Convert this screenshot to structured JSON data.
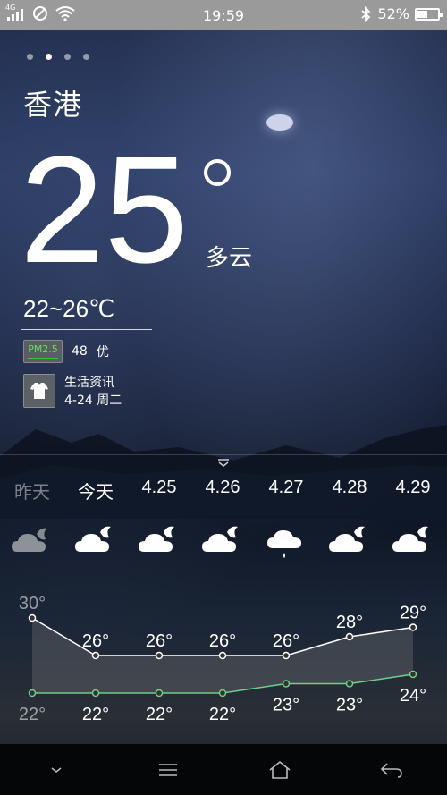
{
  "status_bar": {
    "network": "4G",
    "time": "19:59",
    "battery_percent": "52%",
    "battery_level": 0.52,
    "icons": [
      "signal-icon",
      "do-not-disturb-icon",
      "wifi-icon",
      "bluetooth-icon",
      "battery-icon"
    ]
  },
  "pager": {
    "count": 4,
    "active_index": 1
  },
  "current": {
    "city": "香港",
    "temperature": "25",
    "condition": "多云",
    "range": "22~26℃",
    "pm_label": "PM2.5",
    "pm_value": "48",
    "pm_quality": "优",
    "life_title": "生活资讯",
    "life_date": "4-24 周二"
  },
  "forecast": {
    "days": [
      {
        "label": "昨天",
        "icon": "cloudy-night-icon",
        "past": true
      },
      {
        "label": "今天",
        "icon": "partly-cloudy-night-icon",
        "past": false
      },
      {
        "label": "4.25",
        "icon": "partly-cloudy-night-icon",
        "past": false
      },
      {
        "label": "4.26",
        "icon": "partly-cloudy-night-icon",
        "past": false
      },
      {
        "label": "4.27",
        "icon": "rain-icon",
        "past": false
      },
      {
        "label": "4.28",
        "icon": "partly-cloudy-night-icon",
        "past": false
      },
      {
        "label": "4.29",
        "icon": "partly-cloudy-night-icon",
        "past": false
      }
    ]
  },
  "chart_data": {
    "type": "line",
    "categories": [
      "昨天",
      "今天",
      "4.25",
      "4.26",
      "4.27",
      "4.28",
      "4.29"
    ],
    "series": [
      {
        "values": [
          30,
          26,
          26,
          26,
          26,
          28,
          29
        ],
        "color": "#ffffff"
      },
      {
        "values": [
          22,
          22,
          22,
          22,
          23,
          23,
          24
        ],
        "color": "#6fcf8a"
      }
    ],
    "labels_high": [
      "30°",
      "26°",
      "26°",
      "26°",
      "26°",
      "28°",
      "29°"
    ],
    "labels_low": [
      "22°",
      "22°",
      "22°",
      "22°",
      "23°",
      "23°",
      "24°"
    ],
    "grid": false
  },
  "nav": {
    "icons": [
      "chevron-down-icon",
      "menu-icon",
      "home-icon",
      "back-icon"
    ]
  }
}
